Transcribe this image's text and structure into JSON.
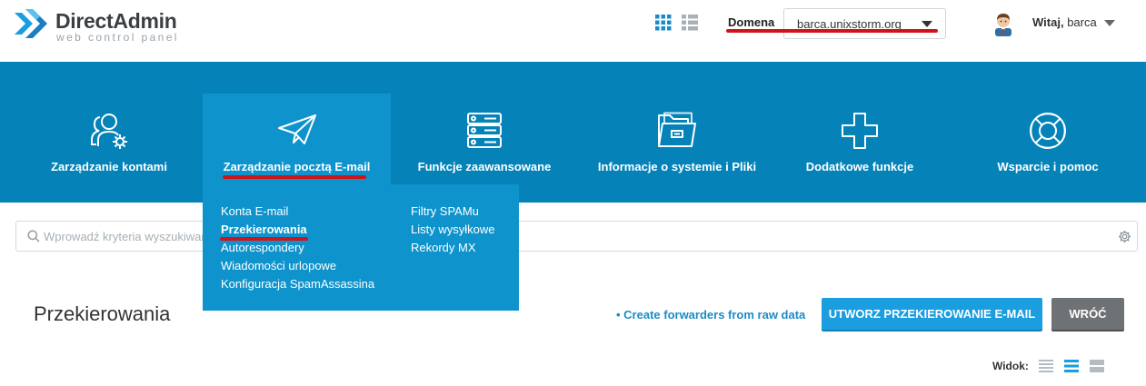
{
  "header": {
    "brand_name": "DirectAdmin",
    "brand_tagline": "web control panel",
    "domain_label": "Domena",
    "domain_value": "barca.unixstorm.org",
    "welcome_label": "Witaj,",
    "username": "barca"
  },
  "nav": {
    "items": [
      {
        "label": "Zarządzanie kontami",
        "icon": "users-gear-icon"
      },
      {
        "label": "Zarządzanie pocztą E-mail",
        "icon": "paper-plane-icon",
        "active": true
      },
      {
        "label": "Funkcje zaawansowane",
        "icon": "server-icon"
      },
      {
        "label": "Informacje o systemie i Pliki",
        "icon": "folder-icon"
      },
      {
        "label": "Dodatkowe funkcje",
        "icon": "plus-icon"
      },
      {
        "label": "Wsparcie i pomoc",
        "icon": "lifebuoy-icon"
      }
    ],
    "dropdown": {
      "left_column": [
        "Konta E-mail",
        "Przekierowania",
        "Autorespondery",
        "Wiadomości urlopowe",
        "Konfiguracja SpamAssassina"
      ],
      "right_column": [
        "Filtry SPAMu",
        "Listy wysyłkowe",
        "Rekordy MX"
      ],
      "active_item": "Przekierowania"
    }
  },
  "search": {
    "placeholder": "Wprowadź kryteria wyszukiwania"
  },
  "page": {
    "title": "Przekierowania",
    "raw_link": "• Create forwarders from raw data",
    "create_button": "UTWORZ PRZEKIEROWANIE E-MAIL",
    "back_button": "WRÓĆ",
    "view_label": "Widok:",
    "view_options": [
      "list-view-icon",
      "comfortable-view-icon",
      "grid-view-icon"
    ],
    "active_view": "comfortable-view-icon"
  },
  "colors": {
    "nav_bg": "#0583b8",
    "nav_active_bg": "#0e93cc",
    "primary_button": "#1b9ee0",
    "back_button": "#6f7274",
    "highlight_underline": "#d0141b",
    "link": "#1b8bc6"
  }
}
